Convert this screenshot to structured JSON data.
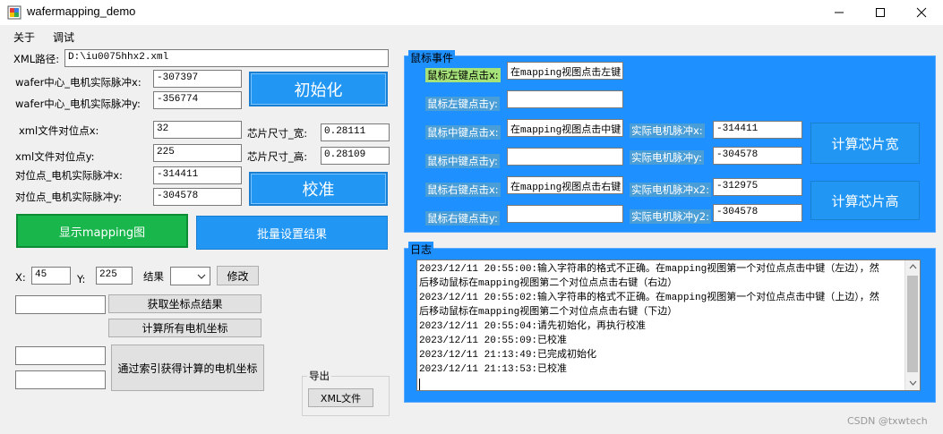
{
  "window": {
    "title": "wafermapping_demo",
    "minimize_icon": "minimize-icon",
    "maximize_icon": "maximize-icon",
    "close_icon": "close-icon"
  },
  "menu": {
    "items": [
      "关于",
      "调试"
    ]
  },
  "left": {
    "xml_path_label": "XML路径:",
    "xml_path_value": "D:\\iu0075hhx2.xml",
    "center_pulse_x_label": "wafer中心_电机实际脉冲x:",
    "center_pulse_x_value": "-307397",
    "center_pulse_y_label": "wafer中心_电机实际脉冲y:",
    "center_pulse_y_value": "-356774",
    "init_button": "初始化",
    "xml_align_x_label": "xml文件对位点x:",
    "xml_align_x_value": "32",
    "xml_align_y_label": "xml文件对位点y:",
    "xml_align_y_value": "225",
    "chip_width_label": "芯片尺寸_宽:",
    "chip_width_value": "0.28111",
    "chip_height_label": "芯片尺寸_高:",
    "chip_height_value": "0.28109",
    "align_pulse_x_label": "对位点_电机实际脉冲x:",
    "align_pulse_x_value": "-314411",
    "align_pulse_y_label": "对位点_电机实际脉冲y:",
    "align_pulse_y_value": "-304578",
    "calibrate_button": "校准",
    "show_mapping_button": "显示mapping图",
    "batch_set_button": "批量设置结果",
    "x_label": "X:",
    "x_value": "45",
    "y_label": "Y:",
    "y_value": "225",
    "result_label": "结果",
    "result_select": "",
    "modify_button": "修改",
    "get_result_button": "获取坐标点结果",
    "calc_all_button": "计算所有电机坐标",
    "calc_by_index_button": "通过索引获得计算的电机坐标",
    "export_group": "导出",
    "xml_file_button": "XML文件"
  },
  "mouse_panel": {
    "title": "鼠标事件",
    "left_x_label": "鼠标左键点击x:",
    "left_x_value": "在mapping视图点击左键",
    "left_y_label": "鼠标左键点击y:",
    "left_y_value": "",
    "mid_x_label": "鼠标中键点击x:",
    "mid_x_value": "在mapping视图点击中键",
    "mid_y_label": "鼠标中键点击y:",
    "mid_y_value": "",
    "right_x_label": "鼠标右键点击x:",
    "right_x_value": "在mapping视图点击右键",
    "right_y_label": "鼠标右键点击y:",
    "right_y_value": "",
    "motor_x_label": "实际电机脉冲x:",
    "motor_x_value": "-314411",
    "motor_y_label": "实际电机脉冲y:",
    "motor_y_value": "-304578",
    "motor_x2_label": "实际电机脉冲x2:",
    "motor_x2_value": "-312975",
    "motor_y2_label": "实际电机脉冲y2:",
    "motor_y2_value": "-304578",
    "calc_width_button": "计算芯片宽",
    "calc_height_button": "计算芯片高"
  },
  "log": {
    "title": "日志",
    "lines": [
      "2023/12/11 20:55:00:输入字符串的格式不正确。在mapping视图第一个对位点点击中键（左边），然",
      "后移动鼠标在mapping视图第二个对位点点击右键（右边）",
      "2023/12/11 20:55:02:输入字符串的格式不正确。在mapping视图第一个对位点点击中键（上边），然",
      "后移动鼠标在mapping视图第二个对位点点击右键（下边）",
      "2023/12/11 20:55:04:请先初始化，再执行校准",
      "2023/12/11 20:55:09:已校准",
      "2023/12/11 21:13:49:已完成初始化",
      "2023/12/11 21:13:53:已校准"
    ]
  },
  "watermark": "CSDN @txwtech",
  "colors": {
    "accent_blue": "#2196f3",
    "panel_blue": "#1e90ff",
    "green": "#19b64c"
  }
}
